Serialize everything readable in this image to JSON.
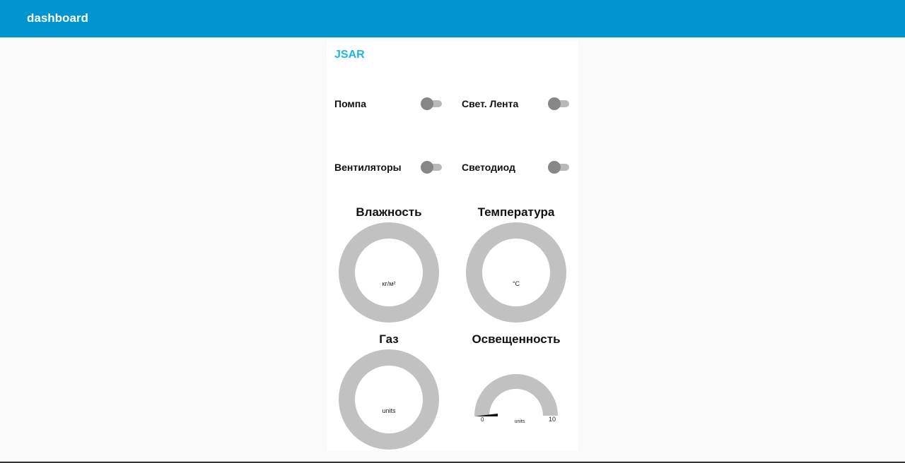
{
  "header": {
    "title": "dashboard",
    "color": "#0095d0"
  },
  "card": {
    "brand": "JSAR",
    "brand_color": "#1db5ea"
  },
  "switches": [
    {
      "label": "Помпа",
      "state": "off"
    },
    {
      "label": "Свет. Лента",
      "state": "off"
    },
    {
      "label": "Вентиляторы",
      "state": "off"
    },
    {
      "label": "Светодиод",
      "state": "off"
    }
  ],
  "gauges": [
    {
      "title": "Влажность",
      "unit": "кг/м²"
    },
    {
      "title": "Температура",
      "unit": "°C"
    },
    {
      "title": "Газ",
      "unit": "units"
    },
    {
      "title": "Освещенность",
      "unit": "units",
      "min": "0",
      "max": "10",
      "value": 0
    }
  ]
}
